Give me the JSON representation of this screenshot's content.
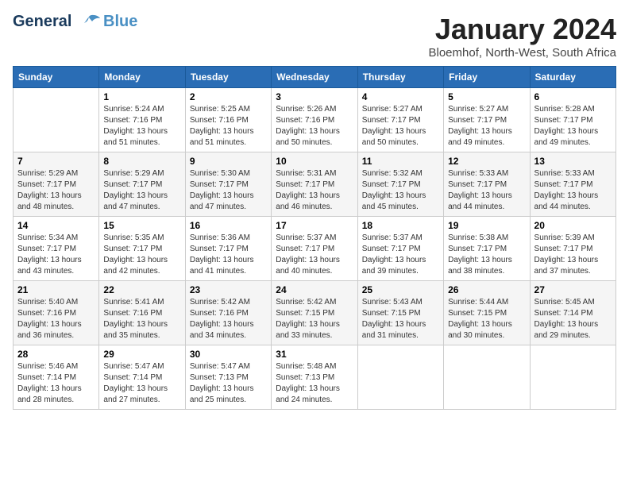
{
  "header": {
    "logo_line1": "General",
    "logo_line2": "Blue",
    "month_title": "January 2024",
    "subtitle": "Bloemhof, North-West, South Africa"
  },
  "days_of_week": [
    "Sunday",
    "Monday",
    "Tuesday",
    "Wednesday",
    "Thursday",
    "Friday",
    "Saturday"
  ],
  "weeks": [
    [
      {
        "day": null,
        "sunrise": null,
        "sunset": null,
        "daylight": null
      },
      {
        "day": "1",
        "sunrise": "5:24 AM",
        "sunset": "7:16 PM",
        "daylight": "13 hours and 51 minutes."
      },
      {
        "day": "2",
        "sunrise": "5:25 AM",
        "sunset": "7:16 PM",
        "daylight": "13 hours and 51 minutes."
      },
      {
        "day": "3",
        "sunrise": "5:26 AM",
        "sunset": "7:16 PM",
        "daylight": "13 hours and 50 minutes."
      },
      {
        "day": "4",
        "sunrise": "5:27 AM",
        "sunset": "7:17 PM",
        "daylight": "13 hours and 50 minutes."
      },
      {
        "day": "5",
        "sunrise": "5:27 AM",
        "sunset": "7:17 PM",
        "daylight": "13 hours and 49 minutes."
      },
      {
        "day": "6",
        "sunrise": "5:28 AM",
        "sunset": "7:17 PM",
        "daylight": "13 hours and 49 minutes."
      }
    ],
    [
      {
        "day": "7",
        "sunrise": "5:29 AM",
        "sunset": "7:17 PM",
        "daylight": "13 hours and 48 minutes."
      },
      {
        "day": "8",
        "sunrise": "5:29 AM",
        "sunset": "7:17 PM",
        "daylight": "13 hours and 47 minutes."
      },
      {
        "day": "9",
        "sunrise": "5:30 AM",
        "sunset": "7:17 PM",
        "daylight": "13 hours and 47 minutes."
      },
      {
        "day": "10",
        "sunrise": "5:31 AM",
        "sunset": "7:17 PM",
        "daylight": "13 hours and 46 minutes."
      },
      {
        "day": "11",
        "sunrise": "5:32 AM",
        "sunset": "7:17 PM",
        "daylight": "13 hours and 45 minutes."
      },
      {
        "day": "12",
        "sunrise": "5:33 AM",
        "sunset": "7:17 PM",
        "daylight": "13 hours and 44 minutes."
      },
      {
        "day": "13",
        "sunrise": "5:33 AM",
        "sunset": "7:17 PM",
        "daylight": "13 hours and 44 minutes."
      }
    ],
    [
      {
        "day": "14",
        "sunrise": "5:34 AM",
        "sunset": "7:17 PM",
        "daylight": "13 hours and 43 minutes."
      },
      {
        "day": "15",
        "sunrise": "5:35 AM",
        "sunset": "7:17 PM",
        "daylight": "13 hours and 42 minutes."
      },
      {
        "day": "16",
        "sunrise": "5:36 AM",
        "sunset": "7:17 PM",
        "daylight": "13 hours and 41 minutes."
      },
      {
        "day": "17",
        "sunrise": "5:37 AM",
        "sunset": "7:17 PM",
        "daylight": "13 hours and 40 minutes."
      },
      {
        "day": "18",
        "sunrise": "5:37 AM",
        "sunset": "7:17 PM",
        "daylight": "13 hours and 39 minutes."
      },
      {
        "day": "19",
        "sunrise": "5:38 AM",
        "sunset": "7:17 PM",
        "daylight": "13 hours and 38 minutes."
      },
      {
        "day": "20",
        "sunrise": "5:39 AM",
        "sunset": "7:17 PM",
        "daylight": "13 hours and 37 minutes."
      }
    ],
    [
      {
        "day": "21",
        "sunrise": "5:40 AM",
        "sunset": "7:16 PM",
        "daylight": "13 hours and 36 minutes."
      },
      {
        "day": "22",
        "sunrise": "5:41 AM",
        "sunset": "7:16 PM",
        "daylight": "13 hours and 35 minutes."
      },
      {
        "day": "23",
        "sunrise": "5:42 AM",
        "sunset": "7:16 PM",
        "daylight": "13 hours and 34 minutes."
      },
      {
        "day": "24",
        "sunrise": "5:42 AM",
        "sunset": "7:15 PM",
        "daylight": "13 hours and 33 minutes."
      },
      {
        "day": "25",
        "sunrise": "5:43 AM",
        "sunset": "7:15 PM",
        "daylight": "13 hours and 31 minutes."
      },
      {
        "day": "26",
        "sunrise": "5:44 AM",
        "sunset": "7:15 PM",
        "daylight": "13 hours and 30 minutes."
      },
      {
        "day": "27",
        "sunrise": "5:45 AM",
        "sunset": "7:14 PM",
        "daylight": "13 hours and 29 minutes."
      }
    ],
    [
      {
        "day": "28",
        "sunrise": "5:46 AM",
        "sunset": "7:14 PM",
        "daylight": "13 hours and 28 minutes."
      },
      {
        "day": "29",
        "sunrise": "5:47 AM",
        "sunset": "7:14 PM",
        "daylight": "13 hours and 27 minutes."
      },
      {
        "day": "30",
        "sunrise": "5:47 AM",
        "sunset": "7:13 PM",
        "daylight": "13 hours and 25 minutes."
      },
      {
        "day": "31",
        "sunrise": "5:48 AM",
        "sunset": "7:13 PM",
        "daylight": "13 hours and 24 minutes."
      },
      {
        "day": null,
        "sunrise": null,
        "sunset": null,
        "daylight": null
      },
      {
        "day": null,
        "sunrise": null,
        "sunset": null,
        "daylight": null
      },
      {
        "day": null,
        "sunrise": null,
        "sunset": null,
        "daylight": null
      }
    ]
  ]
}
